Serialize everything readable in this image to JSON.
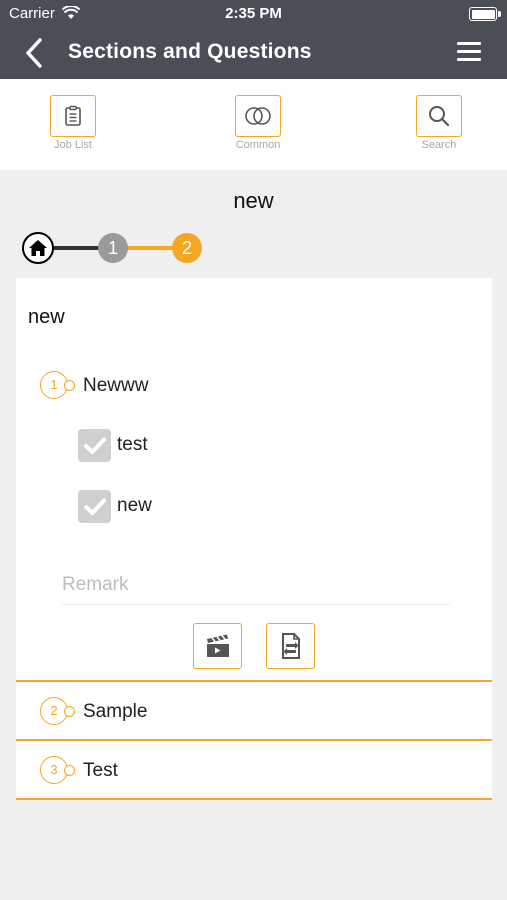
{
  "status_bar": {
    "carrier": "Carrier",
    "time": "2:35 PM"
  },
  "nav": {
    "title": "Sections and Questions"
  },
  "toolbar": {
    "items": [
      {
        "label": "Job List",
        "icon": "clipboard-icon"
      },
      {
        "label": "Common",
        "icon": "overlap-circles-icon"
      },
      {
        "label": "Search",
        "icon": "search-icon"
      }
    ]
  },
  "section": {
    "title": "new",
    "steps": [
      {
        "label": ""
      },
      {
        "label": "1"
      },
      {
        "label": "2"
      }
    ],
    "current_step": 2
  },
  "card": {
    "title": "new",
    "questions": [
      {
        "number": "1",
        "label": "Newww",
        "expanded": true,
        "options": [
          {
            "label": "test",
            "checked": true
          },
          {
            "label": "new",
            "checked": true
          }
        ],
        "remark_placeholder": "Remark",
        "remark_value": ""
      },
      {
        "number": "2",
        "label": "Sample",
        "expanded": false
      },
      {
        "number": "3",
        "label": "Test",
        "expanded": false
      }
    ]
  },
  "colors": {
    "accent": "#f5a623",
    "header": "#4a4f57",
    "background": "#efefef"
  }
}
